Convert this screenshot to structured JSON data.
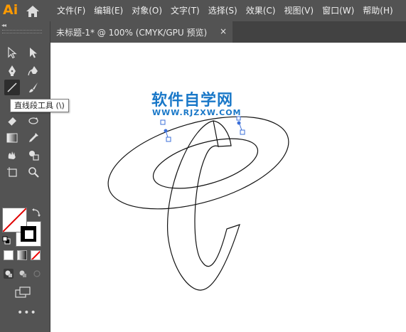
{
  "app": {
    "logo": "Ai"
  },
  "menu": [
    "文件(F)",
    "编辑(E)",
    "对象(O)",
    "文字(T)",
    "选择(S)",
    "效果(C)",
    "视图(V)",
    "窗口(W)",
    "帮助(H)"
  ],
  "toolbar": {
    "collapse_glyph": "◂◂",
    "more_tools": "•••",
    "tooltip": "直线段工具 (\\)",
    "tools": [
      "selection-tool",
      "direct-selection-tool",
      "pen-tool",
      "curvature-tool",
      "line-segment-tool",
      "paintbrush-tool",
      "eraser-tool",
      "rotate-tool",
      "scale-tool",
      "eyedropper-tool",
      "warp-tool",
      "shape-builder-tool",
      "gradient-tool",
      "live-paint-tool",
      "artboard-tool",
      "zoom-tool"
    ]
  },
  "document": {
    "tab_title": "未标题-1* @ 100% (CMYK/GPU 预览)",
    "close_glyph": "×"
  },
  "canvas": {
    "watermark_title": "软件自学网",
    "watermark_url": "WWW.RJZXW.COM"
  },
  "colors": {
    "accent": "#ff9a00",
    "watermark": "#1a78c8",
    "anchor": "#3b6fd8",
    "ui_bg": "#535353"
  }
}
